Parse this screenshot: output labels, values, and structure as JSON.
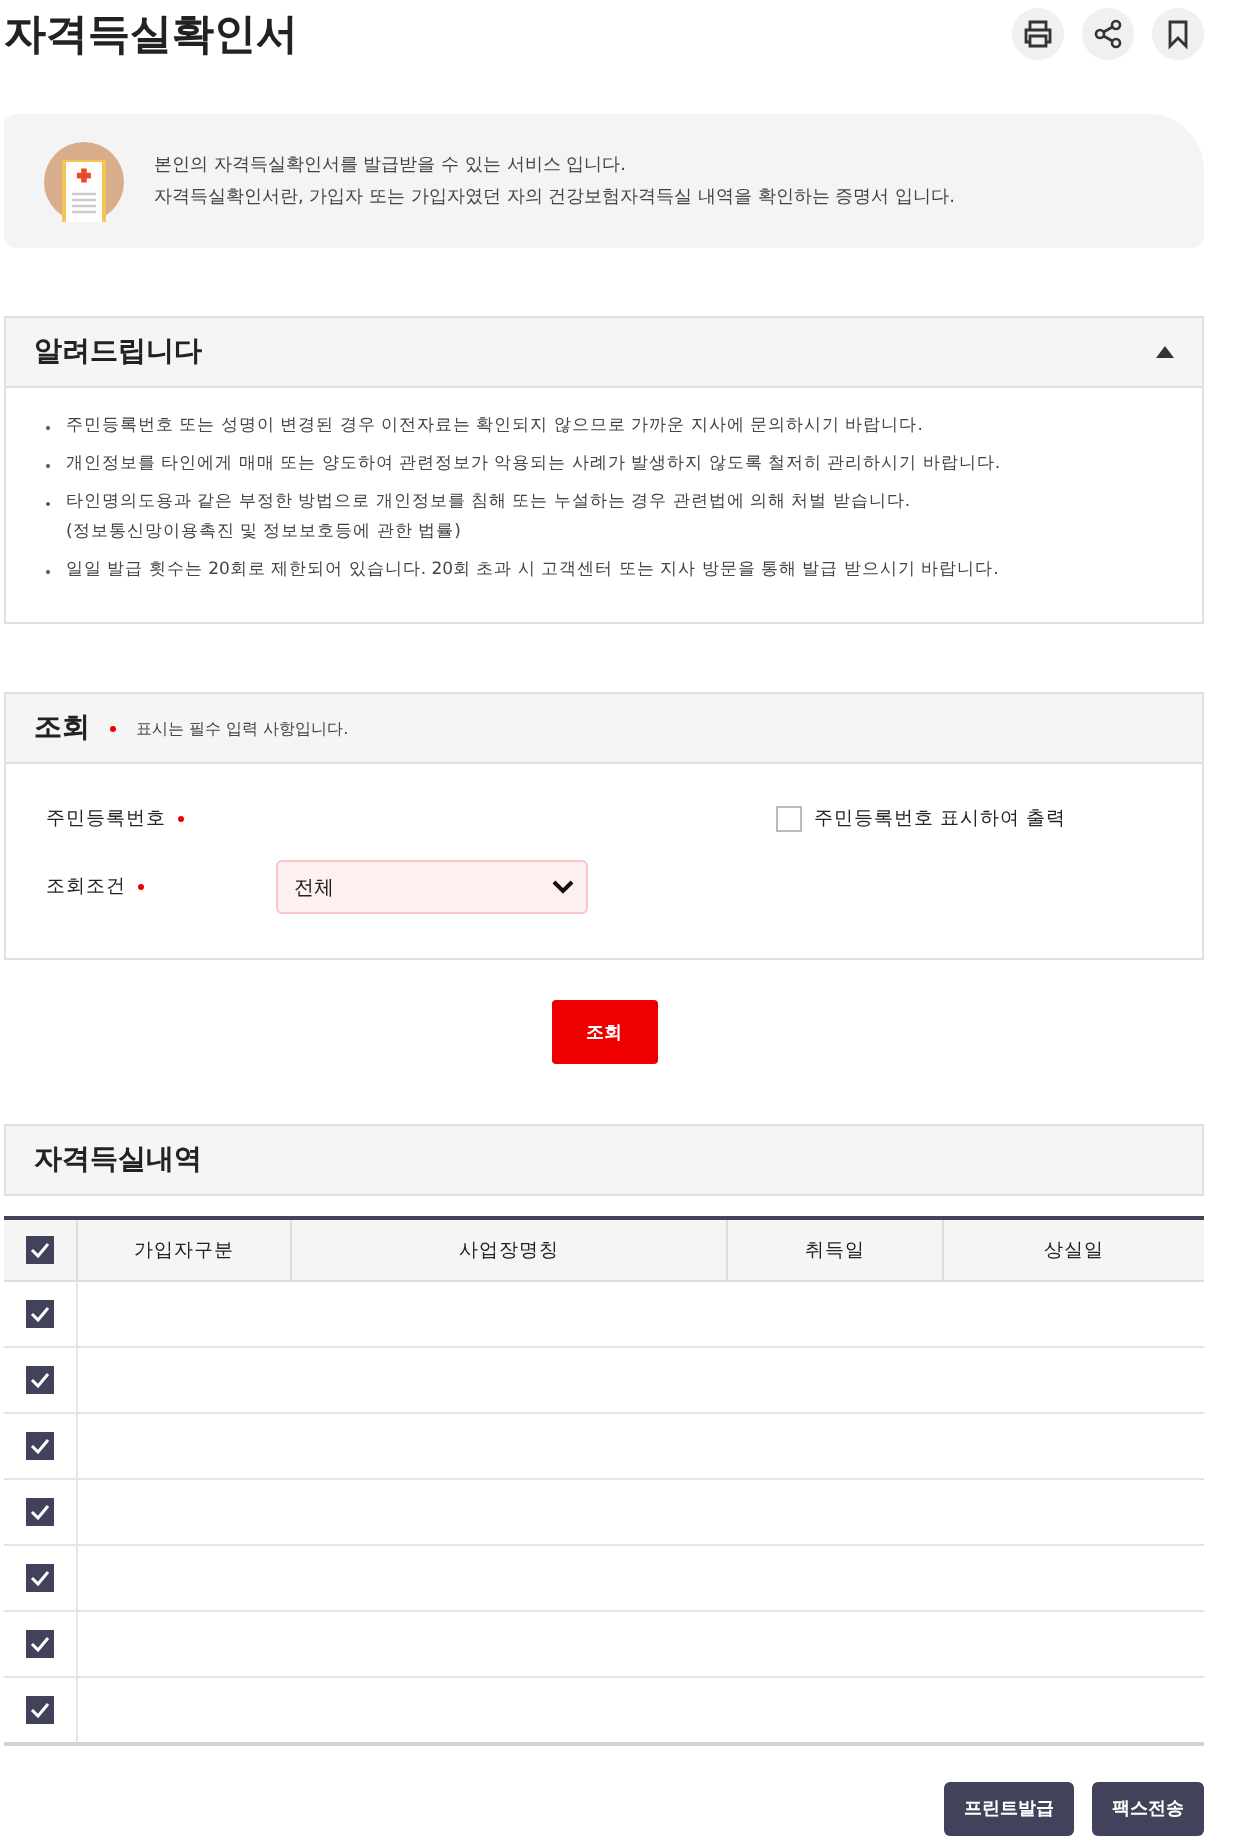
{
  "title": "자격득실확인서",
  "toolbar": [
    {
      "kind": "print"
    },
    {
      "kind": "share"
    },
    {
      "kind": "bookmark"
    }
  ],
  "intro": {
    "lines": [
      "본인의 자격득실확인서를 발급받을 수 있는 서비스 입니다.",
      "자격득실확인서란, 가입자 또는 가입자였던 자의 건강보험자격득실 내역을 확인하는 증명서 입니다."
    ]
  },
  "notice": {
    "title": "알려드립니다",
    "expanded": true,
    "items": [
      {
        "text": "주민등록번호 또는 성명이 변경된 경우 이전자료는 확인되지 않으므로 가까운 지사에 문의하시기 바랍니다."
      },
      {
        "text": "개인정보를 타인에게 매매 또는 양도하여 관련정보가 악용되는 사례가 발생하지 않도록 철저히 관리하시기 바랍니다."
      },
      {
        "text": "타인명의도용과 같은 부정한 방법으로 개인정보를 침해 또는 누설하는 경우 관련법에 의해 처벌 받습니다.",
        "note": "(정보통신망이용촉진 및 정보보호등에 관한 법률)"
      },
      {
        "text": "일일 발급 횟수는 20회로 제한되어 있습니다. 20회 초과 시 고객센터 또는 지사 방문을 통해 발급 받으시기 바랍니다."
      }
    ]
  },
  "search": {
    "title": "조회",
    "required_note": "표시는 필수 입력 사항입니다.",
    "id_label": "주민등록번호",
    "show_id": {
      "label": "주민등록번호 표시하여 출력",
      "checked": false
    },
    "condition_label": "조회조건",
    "condition_value": "전체",
    "button": "조회"
  },
  "history": {
    "title": "자격득실내역",
    "all_checked": true,
    "columns": [
      "가입자구분",
      "사업장명칭",
      "취득일",
      "상실일"
    ],
    "rows": [
      {
        "checked": true
      },
      {
        "checked": true
      },
      {
        "checked": true
      },
      {
        "checked": true
      },
      {
        "checked": true
      },
      {
        "checked": true
      },
      {
        "checked": true
      }
    ]
  },
  "buttons": [
    "프린트발급",
    "팩스전송"
  ]
}
